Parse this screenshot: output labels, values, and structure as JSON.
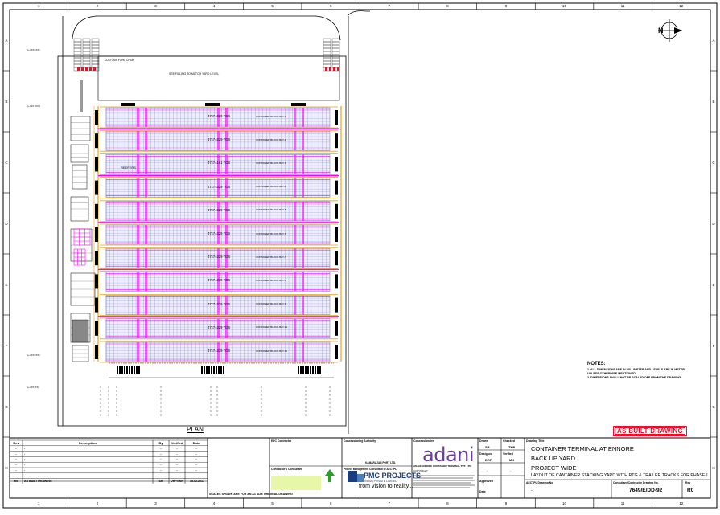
{
  "grid": {
    "columns": [
      "1",
      "2",
      "3",
      "4",
      "5",
      "6",
      "7",
      "8",
      "9",
      "10",
      "11",
      "12"
    ],
    "rows": [
      "A",
      "B",
      "C",
      "D",
      "E",
      "F",
      "G",
      "H"
    ]
  },
  "colors": {
    "rail": "#e8a317",
    "rtg": "#ff00ff",
    "bay": "#7070b0",
    "stamp": "#e8112d",
    "adani": "#6a3d9a",
    "pmc": "#1a3d7c"
  },
  "north_label": "N",
  "plan_label": "PLAN",
  "notes": {
    "title": "NOTES:",
    "items": [
      "1.  ALL DIMENSIONS ARE IN MILLIMETER AND LEVELS ARE IN METER UNLESS OTHERWISE MENTIONED.",
      "2.  DIMENSIONS SHALL NOT BE SCALED OFF FROM THE DRAWING."
    ]
  },
  "stamp": "AS BUILT DRAWING",
  "yard_blocks": [
    {
      "label": "47x7=329 TGS",
      "sublabel": "CONTAINER BLOCK BAY-1"
    },
    {
      "label": "47x7=329 TGS",
      "sublabel": "CONTAINER BLOCK BAY-2"
    },
    {
      "label": "47x7=161 TGS",
      "sublabel": "CONTAINER BLOCK BAY-3"
    },
    {
      "label": "47x7=329 TGS",
      "sublabel": "CONTAINER BLOCK BAY-4"
    },
    {
      "label": "47x7=329 TGS",
      "sublabel": "CONTAINER BLOCK BAY-5"
    },
    {
      "label": "47x7=329 TGS",
      "sublabel": "CONTAINER BLOCK BAY-6"
    },
    {
      "label": "47x7=329 TGS",
      "sublabel": "CONTAINER BLOCK BAY-7"
    },
    {
      "label": "47x7=329 TGS",
      "sublabel": "CONTAINER BLOCK BAY-8"
    },
    {
      "label": "47x7=329 TGS",
      "sublabel": "CONTAINER BLOCK BAY-9"
    },
    {
      "label": "47x7=329 TGS",
      "sublabel": "CONTAINER BLOCK BAY-10"
    },
    {
      "label": "47x7=329 TGS",
      "sublabel": "CONTAINER BLOCK BAY-11"
    }
  ],
  "top_note": "SEE FILLING TO MATCH YARD LEVEL",
  "top_label": "CUSTOMS FORM CHAIN",
  "reefer_text": "REEFERS",
  "level_tags": [
    "(+=XXXXX)",
    "(+=1X.XXX)",
    "(+=XXXXX)",
    "(+=XX.XX)"
  ],
  "revision_table": {
    "headers": [
      "Rev",
      "Description",
      "By",
      "Verified",
      "Date"
    ],
    "rows": [
      [
        "-",
        "-",
        "-",
        "-",
        "-"
      ],
      [
        "-",
        "-",
        "-",
        "-",
        "-"
      ],
      [
        "-",
        "-",
        "-",
        "-",
        "-"
      ],
      [
        "-",
        "-",
        "-",
        "-",
        "-"
      ],
      [
        "-",
        "-",
        "-",
        "-",
        "-"
      ],
      [
        "-",
        "-",
        "-",
        "-",
        "-"
      ],
      [
        "R0",
        "AS BUILT DRAWING",
        "SR",
        "DRP/TNP",
        "15.02.2017"
      ]
    ]
  },
  "title_block": {
    "epc_contractor": "EPC Contractor",
    "concessioning_authority": "Concessioning Authority",
    "concessioning_name": "KAMARAJAR PORT LTD.",
    "concessionaire": "Concessionaire",
    "concessionaire_name": "ADANI ENNORE CONTAINER TERMINAL PVT. LTD.",
    "contractors_consultant": "Contractor's Consultant",
    "pmc_consultant": "Project Management Consultant of AECTPL",
    "adani_logo": "adani",
    "pmc_logo_line1": "PMC PROJECTS",
    "pmc_logo_line2": "(INDIA) PRIVATE LIMITED",
    "pmc_tagline": "from vision to reality...",
    "copyright": "COPYRIGHT",
    "drawn_label": "Drawn",
    "drawn_value": "SR",
    "checked_label": "Checked",
    "checked_value": "TNP",
    "designed_label": "Designed",
    "designed_value": "DRP",
    "verified_label": "Verified",
    "verified_value": "MK",
    "approved_label": "Approved",
    "approved_value": "-",
    "date_label": "Date",
    "date_value": "-",
    "drawing_title_label": "Drawing Title",
    "title_line1": "CONTAINER TERMINAL AT ENNORE",
    "title_line2": "BACK UP YARD",
    "title_line3": "PROJECT WIDE",
    "title_line4": "LAYOUT OF CANTAINER STACKING YARD WITH RTG & TRAILER TRACKS FOR PHASE-I",
    "aectpl_drawing_label": "AECTPL Drawing No.",
    "aectpl_drawing_value": "-",
    "consultant_drawing_label": "Consultant/Contractor Drawing No.",
    "consultant_drawing_value": "7649/E/DD-92",
    "rev_label": "Rev",
    "rev_value": "R0",
    "scale_note": "SCALES SHOWN ARE FOR AN A1 SIZE ORIGINAL DRAWING"
  }
}
